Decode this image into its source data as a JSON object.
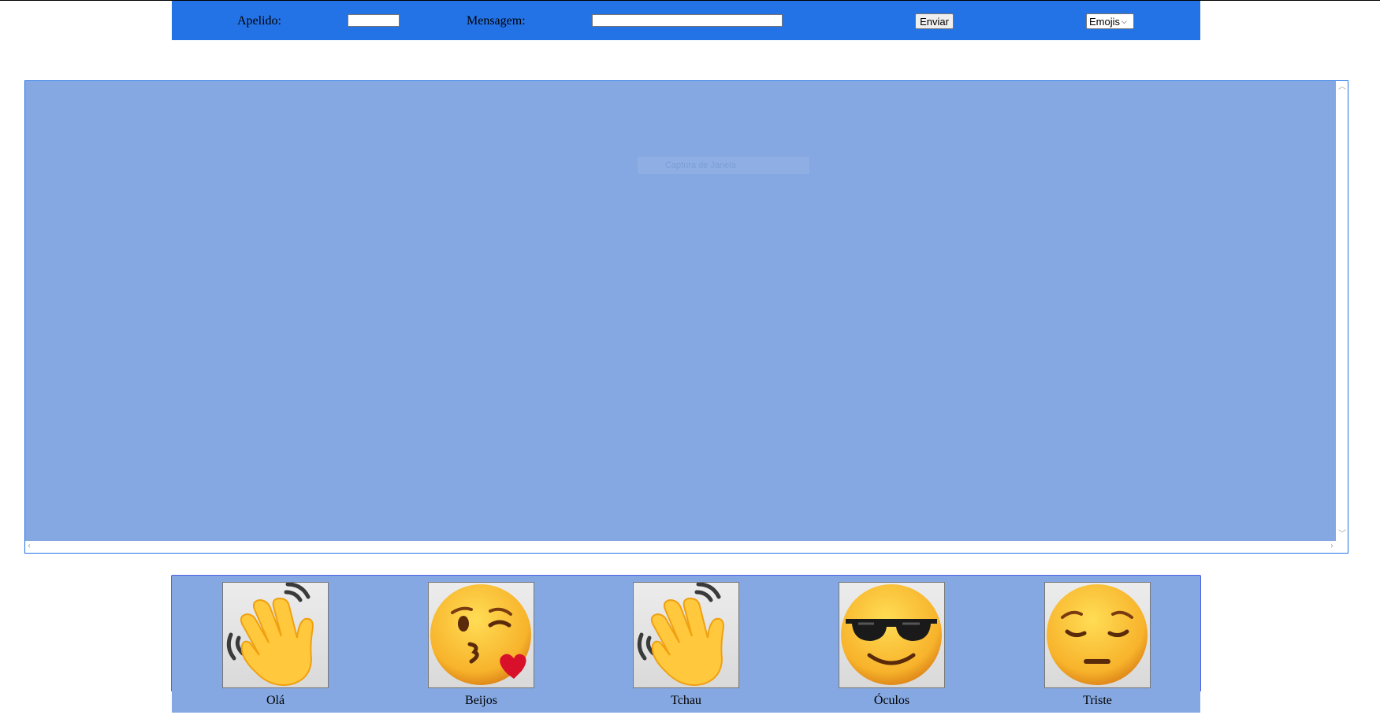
{
  "topbar": {
    "nickname_label": "Apelido:",
    "nickname_value": "",
    "message_label": "Mensagem:",
    "message_value": "",
    "send_label": "Enviar",
    "emoji_select_value": "Emojis",
    "color": "#2473e6"
  },
  "chat": {
    "background": "#85a8e2",
    "overlay_text": "Captura de Janela"
  },
  "emojis": [
    {
      "label": "Olá",
      "icon": "waving-hand"
    },
    {
      "label": "Beijos",
      "icon": "face-blowing-kiss"
    },
    {
      "label": "Tchau",
      "icon": "waving-hand"
    },
    {
      "label": "Óculos",
      "icon": "smiling-face-with-sunglasses"
    },
    {
      "label": "Triste",
      "icon": "pensive-face"
    }
  ]
}
